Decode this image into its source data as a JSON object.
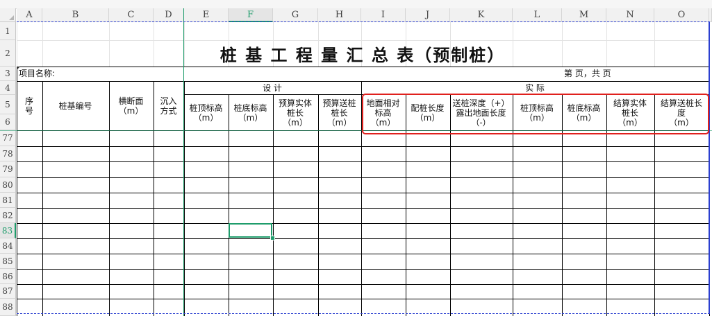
{
  "columns": [
    "A",
    "B",
    "C",
    "D",
    "E",
    "F",
    "G",
    "H",
    "I",
    "J",
    "K",
    "L",
    "M",
    "N",
    "O"
  ],
  "selected_column": "F",
  "rows": [
    "1",
    "2",
    "3",
    "4",
    "5",
    "6",
    "77",
    "78",
    "79",
    "80",
    "81",
    "82",
    "83",
    "84",
    "85",
    "86",
    "87",
    "88"
  ],
  "selected_row": "83",
  "active_cell": "F83",
  "title": "桩  基  工  程  量  汇  总  表（预制桩）",
  "project_name_label": "项目名称:",
  "page_info": "第    页，共    页",
  "group_design": "设    计",
  "group_actual": "实    际",
  "headers": {
    "seq": "序\n号",
    "pile_id": "桩基编号",
    "cross_section": "横断面\n（m）",
    "sink_method": "沉入\n方式",
    "design_top_elev": "桩顶标高\n（m）",
    "design_bottom_elev": "桩底标高\n（m）",
    "budget_solid_len": "预算实体\n桩长\n（m）",
    "budget_send_len": "预算送桩\n桩长\n（m）",
    "ground_rel_elev": "地面相对\n标高\n（m）",
    "pile_config_len": "配桩长度\n（m）",
    "send_depth": "送桩深度（+）\n露出地面长度\n（-）",
    "actual_top_elev": "桩顶标高\n（m）",
    "actual_bottom_elev": "桩底标高\n（m）",
    "settle_solid_len": "结算实体\n桩长\n（m）",
    "settle_send_len": "结算送桩长\n度\n（m）"
  },
  "colors": {
    "highlight_box": "#e0201d",
    "selection": "#1e9c6b",
    "print_area": "#2b3fd0"
  }
}
